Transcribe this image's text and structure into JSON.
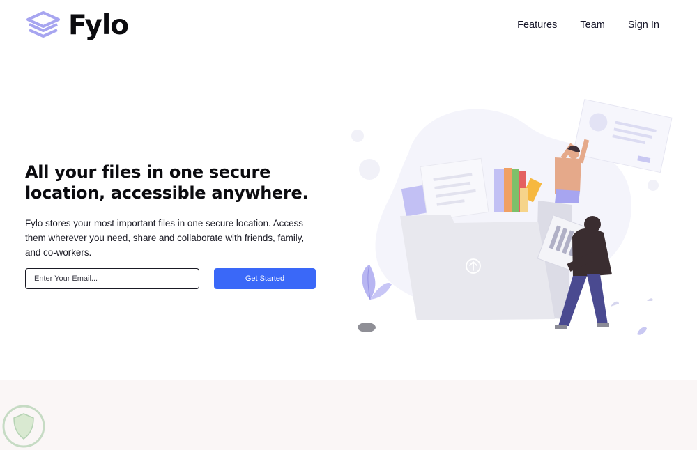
{
  "brand": {
    "name": "Fylo",
    "logo_icon": "stacked-layers-icon",
    "accent": "#3a68f8",
    "logo_color": "#a7a5f0"
  },
  "nav": {
    "items": [
      {
        "label": "Features"
      },
      {
        "label": "Team"
      },
      {
        "label": "Sign In"
      }
    ]
  },
  "hero": {
    "title": "All your files in one secure location, accessible anywhere.",
    "text": "Fylo stores your most important files in one secure location. Access them wherever you need, share and collaborate with friends, family, and co-workers.",
    "email_placeholder": "Enter Your Email...",
    "email_value": "",
    "cta_label": "Get Started",
    "illustration": "people-uploading-files-illustration",
    "upload_icon": "upload-arrow-icon"
  },
  "footer_band": {
    "color": "#faf6f6",
    "watermark_icon": "shield-watermark-icon"
  }
}
